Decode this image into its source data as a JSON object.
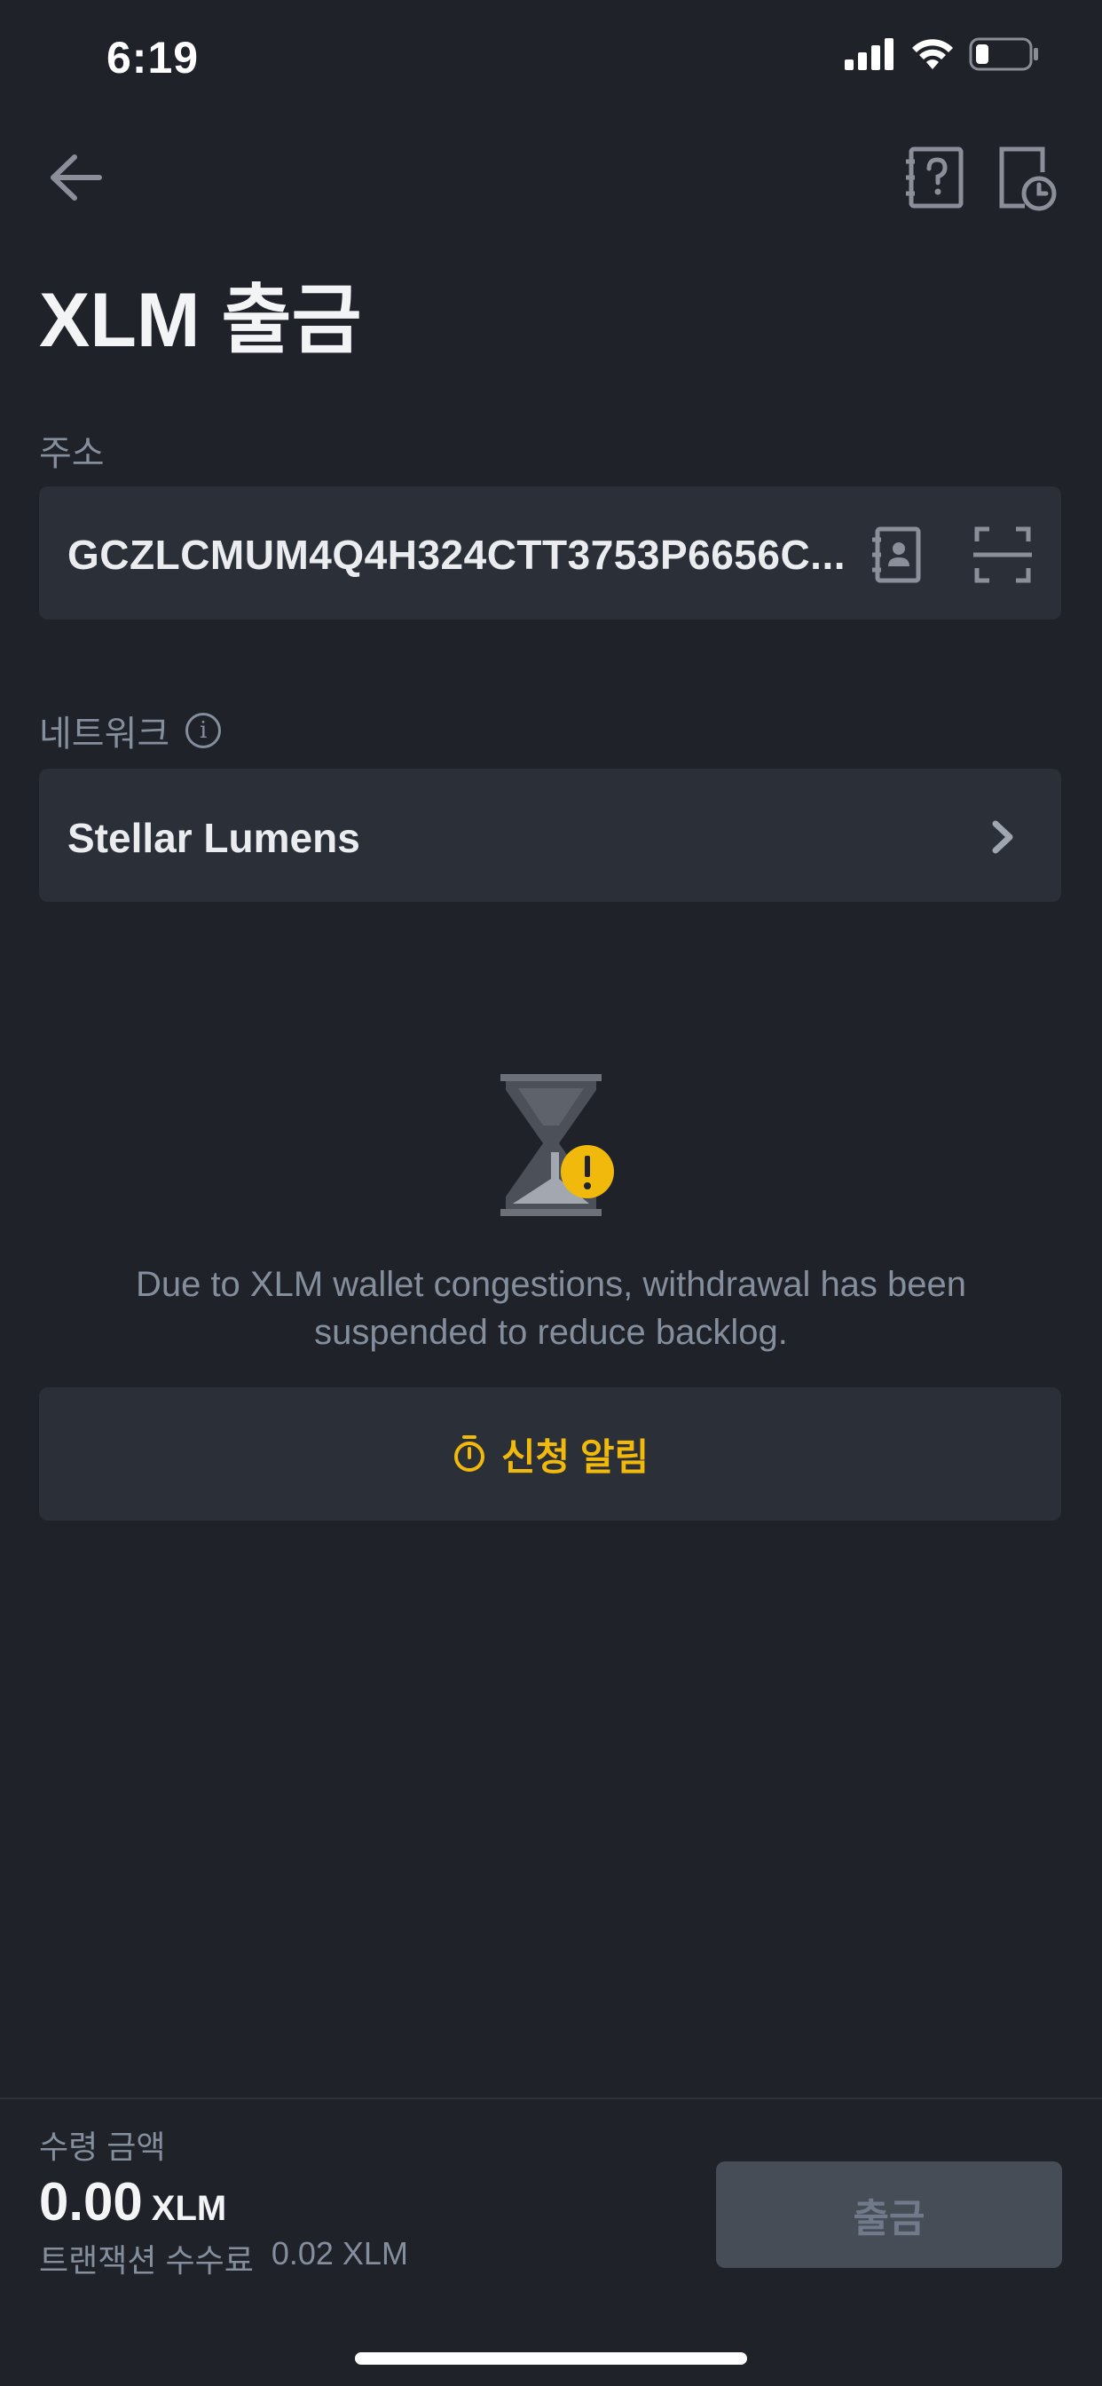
{
  "status_bar": {
    "time": "6:19",
    "icons": [
      "signal-icon",
      "wifi-icon",
      "battery-icon"
    ]
  },
  "header": {
    "title": "XLM 출금",
    "icons": [
      "back-arrow-icon",
      "help-book-icon",
      "history-clock-icon"
    ]
  },
  "address": {
    "label": "주소",
    "value": "GCZLCMUM4Q4H324CTT3753P6656C..."
  },
  "network": {
    "label": "네트워크",
    "value": "Stellar Lumens"
  },
  "notice": {
    "message": "Due to XLM wallet congestions, withdrawal has been suspended to reduce backlog.",
    "notify_label": "신청 알림"
  },
  "summary": {
    "receive_label": "수령 금액",
    "amount": "0.00",
    "unit": "XLM",
    "fee_label": "트랜잭션 수수료",
    "fee_value": "0.02 XLM",
    "withdraw_label": "출금"
  },
  "colors": {
    "background": "#1f2229",
    "input_bg": "#2b2f38",
    "accent": "#f0b90b",
    "muted": "#848e9c",
    "button_disabled": "#474d57"
  }
}
